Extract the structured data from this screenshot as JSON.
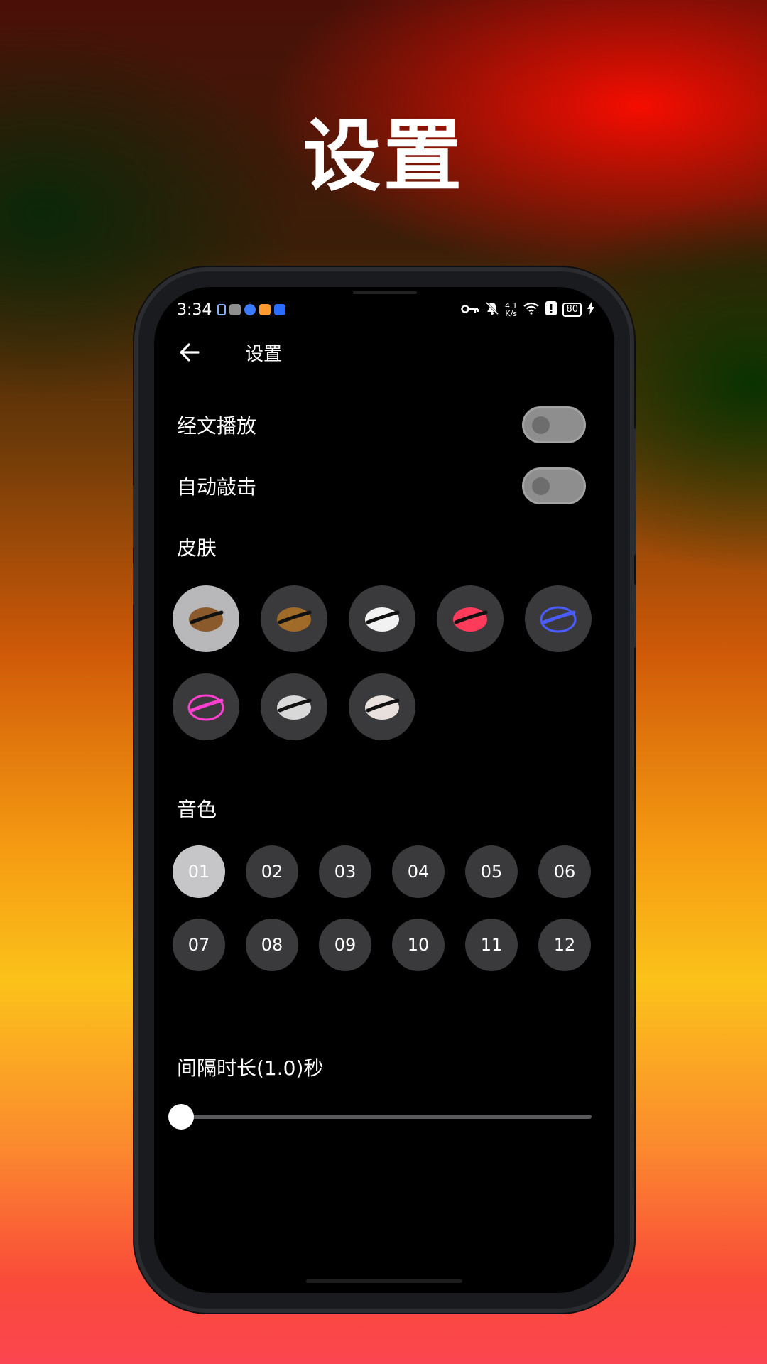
{
  "promo_title": "设置",
  "status_bar": {
    "time": "3:34",
    "net_speed_value": "4.1",
    "net_speed_unit": "K/s",
    "battery": "80"
  },
  "app_bar": {
    "title": "设置",
    "back_icon": "arrow-left-icon"
  },
  "settings": {
    "sutra_play": {
      "label": "经文播放",
      "on": false
    },
    "auto_strike": {
      "label": "自动敲击",
      "on": false
    }
  },
  "skins": {
    "title": "皮肤",
    "selected_index": 0,
    "items": [
      {
        "name": "wood-fish-natural",
        "color": "#8a5a2c"
      },
      {
        "name": "wood-fish-bronze",
        "color": "#a06a28"
      },
      {
        "name": "wood-fish-white",
        "color": "#f2f2f2"
      },
      {
        "name": "wood-fish-glitch",
        "color": "#ff3b5c"
      },
      {
        "name": "wood-fish-neon-blue",
        "color": "#4b5cff"
      },
      {
        "name": "wood-fish-neon-pink",
        "color": "#ff3fd0"
      },
      {
        "name": "wood-fish-christmas",
        "color": "#d8d8d8"
      },
      {
        "name": "wood-fish-lion-dance",
        "color": "#e8e0dc"
      }
    ]
  },
  "sounds": {
    "title": "音色",
    "selected_index": 0,
    "items": [
      "01",
      "02",
      "03",
      "04",
      "05",
      "06",
      "07",
      "08",
      "09",
      "10",
      "11",
      "12"
    ]
  },
  "interval": {
    "label": "间隔时长(1.0)秒",
    "value_fraction": 0.0
  }
}
